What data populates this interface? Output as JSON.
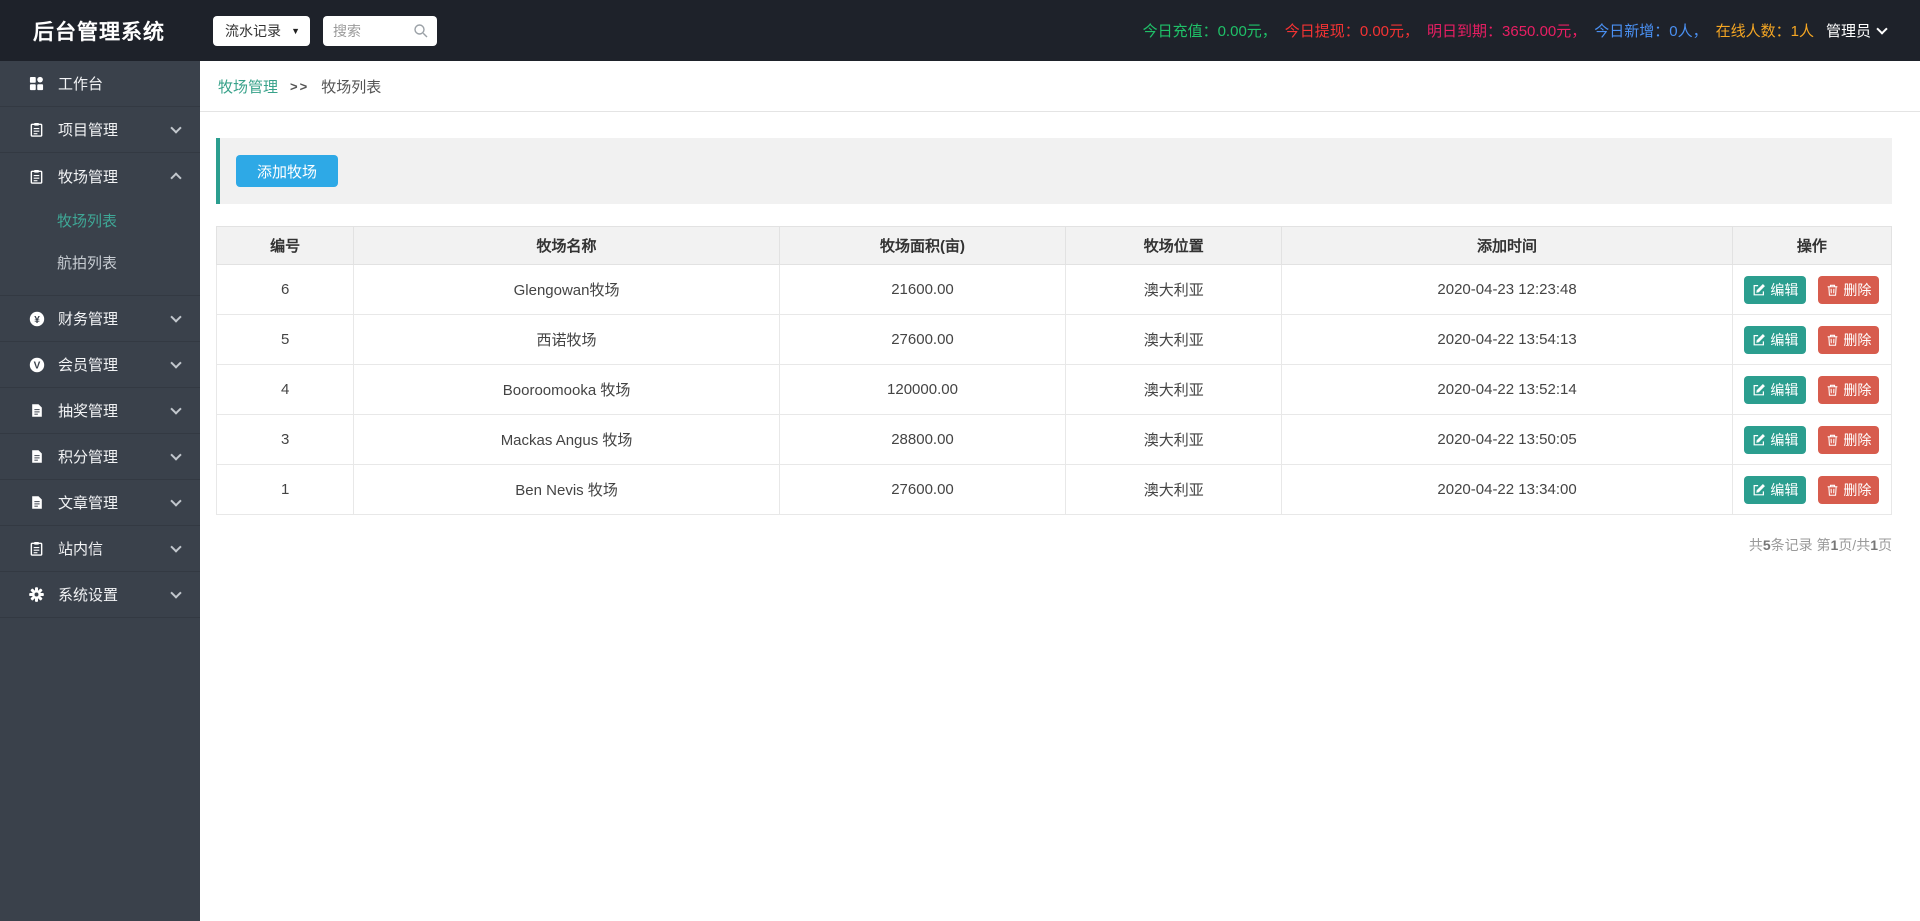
{
  "header": {
    "title": "后台管理系统",
    "nav_select": {
      "value": "流水记录",
      "caret": "▼"
    },
    "search": {
      "placeholder": "搜索"
    },
    "stats": [
      {
        "label": "今日充值：",
        "value": "0.00元，"
      },
      {
        "label": "今日提现：",
        "value": "0.00元，"
      },
      {
        "label": "明日到期：",
        "value": "3650.00元，"
      },
      {
        "label": "今日新增：",
        "value": "0人，"
      },
      {
        "label": "在线人数：",
        "value": "1人"
      }
    ],
    "admin": {
      "label": "管理员"
    }
  },
  "sidebar": {
    "items": [
      {
        "label": "工作台"
      },
      {
        "label": "项目管理"
      },
      {
        "label": "牧场管理",
        "children": [
          {
            "label": "牧场列表"
          },
          {
            "label": "航拍列表"
          }
        ]
      },
      {
        "label": "财务管理"
      },
      {
        "label": "会员管理"
      },
      {
        "label": "抽奖管理"
      },
      {
        "label": "积分管理"
      },
      {
        "label": "文章管理"
      },
      {
        "label": "站内信"
      },
      {
        "label": "系统设置"
      }
    ]
  },
  "breadcrumb": {
    "section": "牧场管理",
    "separator": ">>",
    "page": "牧场列表"
  },
  "toolbar": {
    "add_button": "添加牧场"
  },
  "table": {
    "columns": [
      "编号",
      "牧场名称",
      "牧场面积(亩)",
      "牧场位置",
      "添加时间",
      "操作"
    ],
    "rows": [
      {
        "id": "6",
        "name": "Glengowan牧场",
        "area": "21600.00",
        "location": "澳大利亚",
        "time": "2020-04-23 12:23:48"
      },
      {
        "id": "5",
        "name": "西诺牧场",
        "area": "27600.00",
        "location": "澳大利亚",
        "time": "2020-04-22 13:54:13"
      },
      {
        "id": "4",
        "name": "Booroomooka 牧场",
        "area": "120000.00",
        "location": "澳大利亚",
        "time": "2020-04-22 13:52:14"
      },
      {
        "id": "3",
        "name": "Mackas Angus 牧场",
        "area": "28800.00",
        "location": "澳大利亚",
        "time": "2020-04-22 13:50:05"
      },
      {
        "id": "1",
        "name": "Ben Nevis 牧场",
        "area": "27600.00",
        "location": "澳大利亚",
        "time": "2020-04-22 13:34:00"
      }
    ],
    "actions": {
      "edit": "编辑",
      "delete": "删除"
    }
  },
  "pagination": {
    "seg1": "共",
    "count": "5",
    "seg2": "条记录 第",
    "page": "1",
    "seg3": "页/共",
    "total_pages": "1",
    "seg4": "页"
  },
  "colors": {
    "header_bg": "#1e222a",
    "sidebar_bg": "#3a414b",
    "accent_teal": "#2b9e8f",
    "active_menu": "#3fa796",
    "primary_blue": "#2ea9e6",
    "danger_red": "#d75c4d",
    "stat_green": "#1fc168",
    "stat_red": "#f53333",
    "stat_pink": "#e91e63",
    "stat_blue": "#4a90f2",
    "stat_orange": "#f5a623"
  }
}
